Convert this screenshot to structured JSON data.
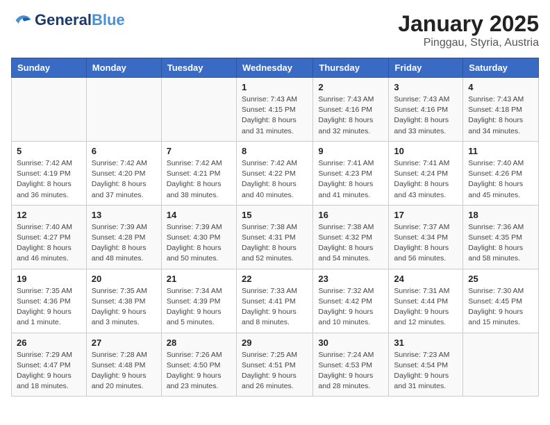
{
  "header": {
    "logo_general": "General",
    "logo_blue": "Blue",
    "title": "January 2025",
    "subtitle": "Pinggau, Styria, Austria"
  },
  "calendar": {
    "days_of_week": [
      "Sunday",
      "Monday",
      "Tuesday",
      "Wednesday",
      "Thursday",
      "Friday",
      "Saturday"
    ],
    "weeks": [
      [
        {
          "day": "",
          "info": ""
        },
        {
          "day": "",
          "info": ""
        },
        {
          "day": "",
          "info": ""
        },
        {
          "day": "1",
          "info": "Sunrise: 7:43 AM\nSunset: 4:15 PM\nDaylight: 8 hours and 31 minutes."
        },
        {
          "day": "2",
          "info": "Sunrise: 7:43 AM\nSunset: 4:16 PM\nDaylight: 8 hours and 32 minutes."
        },
        {
          "day": "3",
          "info": "Sunrise: 7:43 AM\nSunset: 4:16 PM\nDaylight: 8 hours and 33 minutes."
        },
        {
          "day": "4",
          "info": "Sunrise: 7:43 AM\nSunset: 4:18 PM\nDaylight: 8 hours and 34 minutes."
        }
      ],
      [
        {
          "day": "5",
          "info": "Sunrise: 7:42 AM\nSunset: 4:19 PM\nDaylight: 8 hours and 36 minutes."
        },
        {
          "day": "6",
          "info": "Sunrise: 7:42 AM\nSunset: 4:20 PM\nDaylight: 8 hours and 37 minutes."
        },
        {
          "day": "7",
          "info": "Sunrise: 7:42 AM\nSunset: 4:21 PM\nDaylight: 8 hours and 38 minutes."
        },
        {
          "day": "8",
          "info": "Sunrise: 7:42 AM\nSunset: 4:22 PM\nDaylight: 8 hours and 40 minutes."
        },
        {
          "day": "9",
          "info": "Sunrise: 7:41 AM\nSunset: 4:23 PM\nDaylight: 8 hours and 41 minutes."
        },
        {
          "day": "10",
          "info": "Sunrise: 7:41 AM\nSunset: 4:24 PM\nDaylight: 8 hours and 43 minutes."
        },
        {
          "day": "11",
          "info": "Sunrise: 7:40 AM\nSunset: 4:26 PM\nDaylight: 8 hours and 45 minutes."
        }
      ],
      [
        {
          "day": "12",
          "info": "Sunrise: 7:40 AM\nSunset: 4:27 PM\nDaylight: 8 hours and 46 minutes."
        },
        {
          "day": "13",
          "info": "Sunrise: 7:39 AM\nSunset: 4:28 PM\nDaylight: 8 hours and 48 minutes."
        },
        {
          "day": "14",
          "info": "Sunrise: 7:39 AM\nSunset: 4:30 PM\nDaylight: 8 hours and 50 minutes."
        },
        {
          "day": "15",
          "info": "Sunrise: 7:38 AM\nSunset: 4:31 PM\nDaylight: 8 hours and 52 minutes."
        },
        {
          "day": "16",
          "info": "Sunrise: 7:38 AM\nSunset: 4:32 PM\nDaylight: 8 hours and 54 minutes."
        },
        {
          "day": "17",
          "info": "Sunrise: 7:37 AM\nSunset: 4:34 PM\nDaylight: 8 hours and 56 minutes."
        },
        {
          "day": "18",
          "info": "Sunrise: 7:36 AM\nSunset: 4:35 PM\nDaylight: 8 hours and 58 minutes."
        }
      ],
      [
        {
          "day": "19",
          "info": "Sunrise: 7:35 AM\nSunset: 4:36 PM\nDaylight: 9 hours and 1 minute."
        },
        {
          "day": "20",
          "info": "Sunrise: 7:35 AM\nSunset: 4:38 PM\nDaylight: 9 hours and 3 minutes."
        },
        {
          "day": "21",
          "info": "Sunrise: 7:34 AM\nSunset: 4:39 PM\nDaylight: 9 hours and 5 minutes."
        },
        {
          "day": "22",
          "info": "Sunrise: 7:33 AM\nSunset: 4:41 PM\nDaylight: 9 hours and 8 minutes."
        },
        {
          "day": "23",
          "info": "Sunrise: 7:32 AM\nSunset: 4:42 PM\nDaylight: 9 hours and 10 minutes."
        },
        {
          "day": "24",
          "info": "Sunrise: 7:31 AM\nSunset: 4:44 PM\nDaylight: 9 hours and 12 minutes."
        },
        {
          "day": "25",
          "info": "Sunrise: 7:30 AM\nSunset: 4:45 PM\nDaylight: 9 hours and 15 minutes."
        }
      ],
      [
        {
          "day": "26",
          "info": "Sunrise: 7:29 AM\nSunset: 4:47 PM\nDaylight: 9 hours and 18 minutes."
        },
        {
          "day": "27",
          "info": "Sunrise: 7:28 AM\nSunset: 4:48 PM\nDaylight: 9 hours and 20 minutes."
        },
        {
          "day": "28",
          "info": "Sunrise: 7:26 AM\nSunset: 4:50 PM\nDaylight: 9 hours and 23 minutes."
        },
        {
          "day": "29",
          "info": "Sunrise: 7:25 AM\nSunset: 4:51 PM\nDaylight: 9 hours and 26 minutes."
        },
        {
          "day": "30",
          "info": "Sunrise: 7:24 AM\nSunset: 4:53 PM\nDaylight: 9 hours and 28 minutes."
        },
        {
          "day": "31",
          "info": "Sunrise: 7:23 AM\nSunset: 4:54 PM\nDaylight: 9 hours and 31 minutes."
        },
        {
          "day": "",
          "info": ""
        }
      ]
    ]
  }
}
